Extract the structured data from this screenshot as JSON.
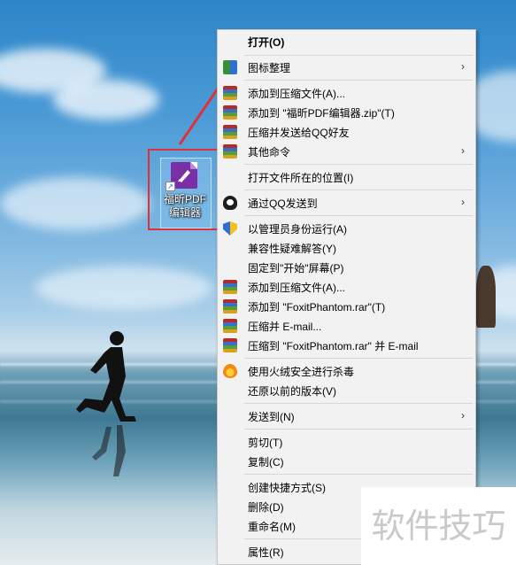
{
  "desktop": {
    "icon_label": "福昕PDF编辑器"
  },
  "menu": {
    "items": [
      {
        "label": "打开(O)",
        "bold": true,
        "icon": null,
        "submenu": false
      },
      {
        "label": "图标整理",
        "icon": "grid-icon",
        "submenu": true
      },
      {
        "label": "添加到压缩文件(A)...",
        "icon": "archive-icon",
        "submenu": false
      },
      {
        "label": "添加到 \"福昕PDF编辑器.zip\"(T)",
        "icon": "archive-icon",
        "submenu": false
      },
      {
        "label": "压缩并发送给QQ好友",
        "icon": "archive-icon",
        "submenu": false
      },
      {
        "label": "其他命令",
        "icon": "archive-icon",
        "submenu": true
      },
      {
        "label": "打开文件所在的位置(I)",
        "icon": null,
        "submenu": false
      },
      {
        "label": "通过QQ发送到",
        "icon": "qq-icon",
        "submenu": true
      },
      {
        "label": "以管理员身份运行(A)",
        "icon": "shield-icon",
        "submenu": false
      },
      {
        "label": "兼容性疑难解答(Y)",
        "icon": null,
        "submenu": false
      },
      {
        "label": "固定到\"开始\"屏幕(P)",
        "icon": null,
        "submenu": false
      },
      {
        "label": "添加到压缩文件(A)...",
        "icon": "winrar-icon",
        "submenu": false
      },
      {
        "label": "添加到 \"FoxitPhantom.rar\"(T)",
        "icon": "winrar-icon",
        "submenu": false
      },
      {
        "label": "压缩并 E-mail...",
        "icon": "winrar-icon",
        "submenu": false
      },
      {
        "label": "压缩到 \"FoxitPhantom.rar\" 并 E-mail",
        "icon": "winrar-icon",
        "submenu": false
      },
      {
        "label": "使用火绒安全进行杀毒",
        "icon": "huorong-icon",
        "submenu": false
      },
      {
        "label": "还原以前的版本(V)",
        "icon": null,
        "submenu": false
      },
      {
        "label": "发送到(N)",
        "icon": null,
        "submenu": true
      },
      {
        "label": "剪切(T)",
        "icon": null,
        "submenu": false
      },
      {
        "label": "复制(C)",
        "icon": null,
        "submenu": false
      },
      {
        "label": "创建快捷方式(S)",
        "icon": null,
        "submenu": false
      },
      {
        "label": "删除(D)",
        "icon": null,
        "submenu": false
      },
      {
        "label": "重命名(M)",
        "icon": null,
        "submenu": false
      },
      {
        "label": "属性(R)",
        "icon": null,
        "submenu": false
      }
    ],
    "submenu_arrow": "›"
  },
  "watermark": {
    "text": "软件技巧"
  },
  "colors": {
    "highlight_box": "#e0313a",
    "arrow": "#e0313a",
    "menu_bg": "#f2f2f2"
  }
}
